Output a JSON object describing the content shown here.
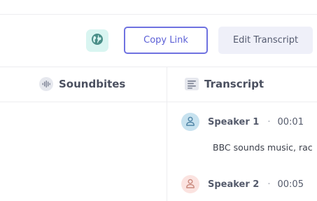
{
  "toolbar": {
    "copy_label": "Copy Link",
    "edit_label": "Edit Transcript"
  },
  "tabs": {
    "soundbites": "Soundbites",
    "transcript": "Transcript"
  },
  "transcript": {
    "separator": "·",
    "entries": [
      {
        "speaker": "Speaker 1",
        "time": "00:01",
        "text": "BBC sounds music, rac",
        "avatar_color": "#c7e2ef",
        "icon_color": "#4f84a6"
      },
      {
        "speaker": "Speaker 2",
        "time": "00:05",
        "avatar_color": "#fbe3e0",
        "icon_color": "#c98a7e"
      }
    ]
  },
  "colors": {
    "accent": "#5b5fd6",
    "globe_bg": "#d9f5f1",
    "globe_icon": "#4a8f88"
  }
}
